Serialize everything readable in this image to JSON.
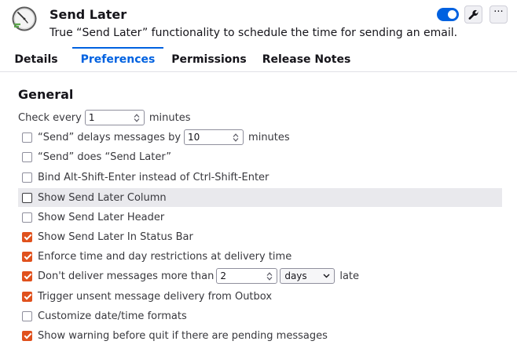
{
  "addon": {
    "name": "Send Later",
    "description": "True “Send Later” functionality to schedule the time for sending an email.",
    "enabled": true
  },
  "header": {
    "toggle_icon": "toggle-switch",
    "settings_icon": "wrench-icon",
    "more_icon": "ellipsis-icon",
    "more_label": "···"
  },
  "tabs": [
    {
      "label": "Details"
    },
    {
      "label": "Preferences",
      "active": true
    },
    {
      "label": "Permissions"
    },
    {
      "label": "Release Notes"
    }
  ],
  "colors": {
    "accent": "#0061e0",
    "checkbox": "#e0511d"
  },
  "general": {
    "title": "General",
    "check_every": {
      "label": "Check every",
      "value": "1",
      "unit": "minutes"
    },
    "send_delays": {
      "label": "“Send” delays messages by",
      "value": "10",
      "unit": "minutes",
      "checked": false
    },
    "send_does": {
      "label": "“Send” does “Send Later”",
      "checked": false
    },
    "bind_alt": {
      "label": "Bind Alt-Shift-Enter instead of Ctrl-Shift-Enter",
      "checked": false
    },
    "show_column": {
      "label": "Show Send Later Column",
      "checked": false
    },
    "show_header": {
      "label": "Show Send Later Header",
      "checked": false
    },
    "show_status": {
      "label": "Show Send Later In Status Bar",
      "checked": true
    },
    "enforce": {
      "label": "Enforce time and day restrictions at delivery time",
      "checked": true
    },
    "dont_deliver": {
      "label": "Don't deliver messages more than",
      "value": "2",
      "unit_selected": "days",
      "suffix": "late",
      "checked": true
    },
    "trigger": {
      "label": "Trigger unsent message delivery from Outbox",
      "checked": true
    },
    "customize": {
      "label": "Customize date/time formats",
      "checked": false
    },
    "warn_quit": {
      "label": "Show warning before quit if there are pending messages",
      "checked": true
    }
  }
}
